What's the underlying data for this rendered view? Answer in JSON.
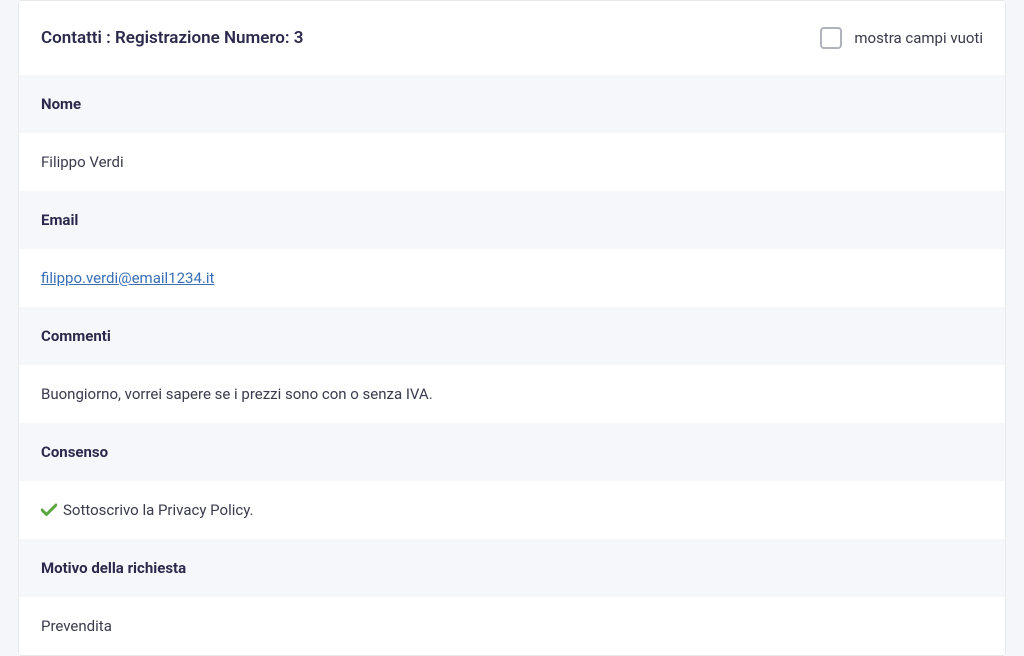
{
  "header": {
    "title": "Contatti : Registrazione Numero: 3",
    "toggleLabel": "mostra campi vuoti"
  },
  "fields": {
    "name": {
      "label": "Nome",
      "value": "Filippo Verdi"
    },
    "email": {
      "label": "Email",
      "value": "filippo.verdi@email1234.it"
    },
    "comments": {
      "label": "Commenti",
      "value": "Buongiorno, vorrei sapere se i prezzi sono con o senza IVA."
    },
    "consent": {
      "label": "Consenso",
      "value": "Sottoscrivo la Privacy Policy."
    },
    "reason": {
      "label": "Motivo della richiesta",
      "value": "Prevendita"
    }
  }
}
